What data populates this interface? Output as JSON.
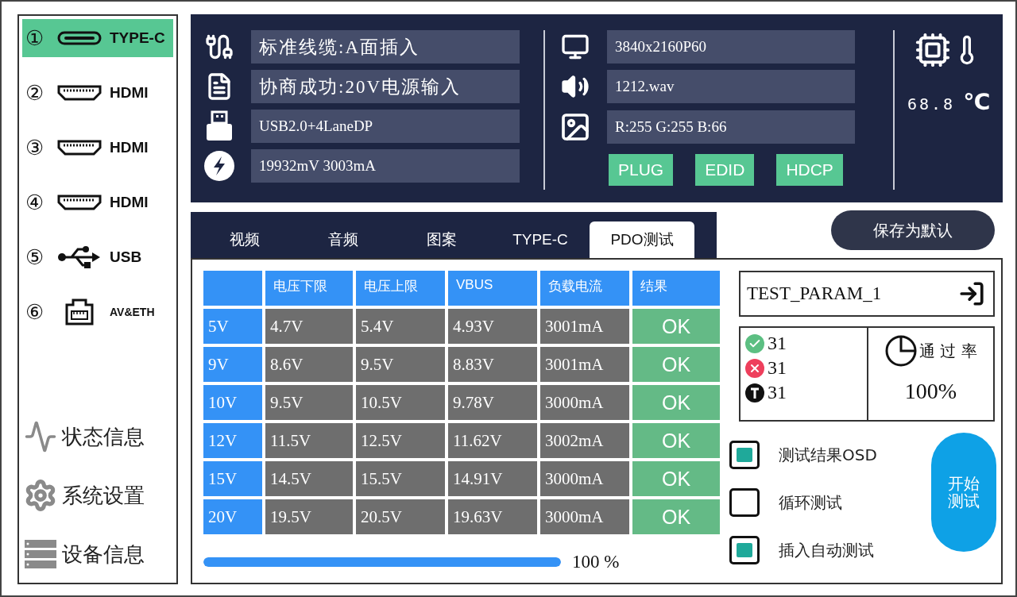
{
  "sidebar": {
    "ports": [
      {
        "number": "①",
        "kind": "typec",
        "label": "TYPE-C",
        "selected": true
      },
      {
        "number": "②",
        "kind": "hdmi",
        "label": "HDMI",
        "selected": false
      },
      {
        "number": "③",
        "kind": "hdmi",
        "label": "HDMI",
        "selected": false
      },
      {
        "number": "④",
        "kind": "hdmi",
        "label": "HDMI",
        "selected": false
      },
      {
        "number": "⑤",
        "kind": "usb",
        "label": "USB",
        "selected": false
      },
      {
        "number": "⑥",
        "kind": "eth",
        "label": "AV&ETH",
        "selected": false
      }
    ],
    "menu": [
      {
        "kind": "status",
        "label": "状态信息"
      },
      {
        "kind": "settings",
        "label": "系统设置"
      },
      {
        "kind": "device",
        "label": "设备信息"
      }
    ]
  },
  "status_panel": {
    "left": [
      {
        "kind": "cable",
        "text": "标准线缆:A面插入",
        "large": true
      },
      {
        "kind": "negotiate",
        "text": "协商成功:20V电源输入",
        "large": true
      },
      {
        "kind": "usb",
        "text": "USB2.0+4LaneDP",
        "large": false
      },
      {
        "kind": "power",
        "text": "19932mV 3003mA",
        "large": false
      }
    ],
    "right": [
      {
        "kind": "monitor",
        "text": "3840x2160P60"
      },
      {
        "kind": "audio",
        "text": "1212.wav"
      },
      {
        "kind": "image",
        "text": "R:255 G:255 B:66"
      }
    ],
    "buttons": [
      "PLUG",
      "EDID",
      "HDCP"
    ],
    "temperature": {
      "value": "68.8",
      "unit": "℃"
    }
  },
  "tabs": [
    {
      "label": "视频",
      "selected": false
    },
    {
      "label": "音频",
      "selected": false
    },
    {
      "label": "图案",
      "selected": false
    },
    {
      "label": "TYPE-C",
      "selected": false
    },
    {
      "label": "PDO测试",
      "selected": true
    }
  ],
  "save_button": "保存为默认",
  "table": {
    "columns": [
      "",
      "电压下限",
      "电压上限",
      "VBUS",
      "负载电流",
      "结果"
    ],
    "rows": [
      {
        "cells": [
          "5V",
          "4.7V",
          "5.4V",
          "4.93V",
          "3001mA"
        ],
        "result": "OK"
      },
      {
        "cells": [
          "9V",
          "8.6V",
          "9.5V",
          "8.83V",
          "3001mA"
        ],
        "result": "OK"
      },
      {
        "cells": [
          "10V",
          "9.5V",
          "10.5V",
          "9.78V",
          "3000mA"
        ],
        "result": "OK"
      },
      {
        "cells": [
          "12V",
          "11.5V",
          "12.5V",
          "11.62V",
          "3002mA"
        ],
        "result": "OK"
      },
      {
        "cells": [
          "15V",
          "14.5V",
          "15.5V",
          "14.91V",
          "3000mA"
        ],
        "result": "OK"
      },
      {
        "cells": [
          "20V",
          "19.5V",
          "20.5V",
          "19.63V",
          "3000mA"
        ],
        "result": "OK"
      }
    ]
  },
  "progress": {
    "level": 1,
    "reading": "100 %"
  },
  "param_field": {
    "value": "TEST_PARAM_1"
  },
  "stats": {
    "counts": [
      {
        "kind": "pass",
        "value": "31"
      },
      {
        "kind": "fail",
        "value": "31"
      },
      {
        "kind": "total",
        "value": "31"
      }
    ],
    "pass_rate": {
      "label": "通 过 率",
      "value": "100%"
    }
  },
  "options": [
    {
      "label": "测试结果OSD",
      "checked": true
    },
    {
      "label": "循环测试",
      "checked": false
    },
    {
      "label": "插入自动测试",
      "checked": true
    }
  ],
  "start_button": "开始测试"
}
